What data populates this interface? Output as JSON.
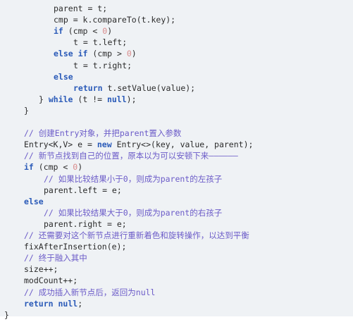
{
  "code_lines": [
    {
      "indent": 10,
      "parts": [
        {
          "t": "parent = t;",
          "c": "tx"
        }
      ]
    },
    {
      "indent": 10,
      "parts": [
        {
          "t": "cmp = k.compareTo(t.key);",
          "c": "tx"
        }
      ]
    },
    {
      "indent": 10,
      "parts": [
        {
          "t": "if",
          "c": "kw"
        },
        {
          "t": " (cmp < ",
          "c": "tx"
        },
        {
          "t": "0",
          "c": "num"
        },
        {
          "t": ")",
          "c": "tx"
        }
      ]
    },
    {
      "indent": 14,
      "parts": [
        {
          "t": "t = t.left;",
          "c": "tx"
        }
      ]
    },
    {
      "indent": 10,
      "parts": [
        {
          "t": "else if",
          "c": "kw"
        },
        {
          "t": " (cmp > ",
          "c": "tx"
        },
        {
          "t": "0",
          "c": "num"
        },
        {
          "t": ")",
          "c": "tx"
        }
      ]
    },
    {
      "indent": 14,
      "parts": [
        {
          "t": "t = t.right;",
          "c": "tx"
        }
      ]
    },
    {
      "indent": 10,
      "parts": [
        {
          "t": "else",
          "c": "kw"
        }
      ]
    },
    {
      "indent": 14,
      "parts": [
        {
          "t": "return",
          "c": "kw"
        },
        {
          "t": " t.setValue(value);",
          "c": "tx"
        }
      ]
    },
    {
      "indent": 7,
      "parts": [
        {
          "t": "} ",
          "c": "tx"
        },
        {
          "t": "while",
          "c": "kw"
        },
        {
          "t": " (t != ",
          "c": "tx"
        },
        {
          "t": "null",
          "c": "kw"
        },
        {
          "t": ");",
          "c": "tx"
        }
      ]
    },
    {
      "indent": 4,
      "parts": [
        {
          "t": "}",
          "c": "tx"
        }
      ]
    },
    {
      "indent": 4,
      "parts": [
        {
          "t": "",
          "c": "tx"
        }
      ]
    },
    {
      "indent": 4,
      "parts": [
        {
          "t": "// 创建Entry对象，并把parent置入参数",
          "c": "cm"
        }
      ]
    },
    {
      "indent": 4,
      "parts": [
        {
          "t": "Entry<K,V> e = ",
          "c": "tx"
        },
        {
          "t": "new",
          "c": "kw"
        },
        {
          "t": " Entry<>(key, value, parent);",
          "c": "tx"
        }
      ]
    },
    {
      "indent": 4,
      "parts": [
        {
          "t": "// 新节点找到自己的位置，原本以为可以安顿下来——————",
          "c": "cm"
        }
      ]
    },
    {
      "indent": 4,
      "parts": [
        {
          "t": "if",
          "c": "kw"
        },
        {
          "t": " (cmp < ",
          "c": "tx"
        },
        {
          "t": "0",
          "c": "num"
        },
        {
          "t": ")",
          "c": "tx"
        }
      ]
    },
    {
      "indent": 8,
      "parts": [
        {
          "t": "// 如果比较结果小于0，则成为parent的左孩子",
          "c": "cm"
        }
      ]
    },
    {
      "indent": 8,
      "parts": [
        {
          "t": "parent.left = e;",
          "c": "tx"
        }
      ]
    },
    {
      "indent": 4,
      "parts": [
        {
          "t": "else",
          "c": "kw"
        }
      ]
    },
    {
      "indent": 8,
      "parts": [
        {
          "t": "// 如果比较结果大于0，则成为parent的右孩子",
          "c": "cm"
        }
      ]
    },
    {
      "indent": 8,
      "parts": [
        {
          "t": "parent.right = e;",
          "c": "tx"
        }
      ]
    },
    {
      "indent": 4,
      "parts": [
        {
          "t": "// 还需要对这个新节点进行重新着色和旋转操作，以达到平衡",
          "c": "cm"
        }
      ]
    },
    {
      "indent": 4,
      "parts": [
        {
          "t": "fixAfterInsertion(e);",
          "c": "tx"
        }
      ]
    },
    {
      "indent": 4,
      "parts": [
        {
          "t": "// 终于融入其中",
          "c": "cm"
        }
      ]
    },
    {
      "indent": 4,
      "parts": [
        {
          "t": "size++;",
          "c": "tx"
        }
      ]
    },
    {
      "indent": 4,
      "parts": [
        {
          "t": "modCount++;",
          "c": "tx"
        }
      ]
    },
    {
      "indent": 4,
      "parts": [
        {
          "t": "// 成功插入新节点后，返回为null",
          "c": "cm"
        }
      ]
    },
    {
      "indent": 4,
      "parts": [
        {
          "t": "return",
          "c": "kw"
        },
        {
          "t": " ",
          "c": "tx"
        },
        {
          "t": "null",
          "c": "kw"
        },
        {
          "t": ";",
          "c": "tx"
        }
      ]
    },
    {
      "indent": 0,
      "parts": [
        {
          "t": "}",
          "c": "tx"
        }
      ]
    }
  ],
  "colors": {
    "background": "#eff2f5",
    "keyword": "#2a5ab8",
    "number": "#d98b8b",
    "comment": "#6b5bc8",
    "text": "#2b2b2b"
  }
}
